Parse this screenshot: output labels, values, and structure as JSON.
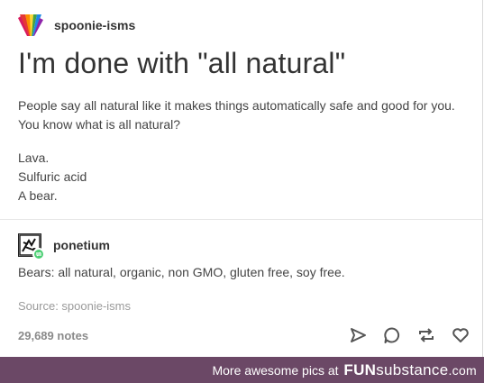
{
  "post": {
    "blog_name": "spoonie-isms",
    "title": "I'm done with \"all natural\"",
    "paragraph_1": "People say all natural like it makes things automatically safe and good for you. You know what is all natural?",
    "list_lines": [
      "Lava.",
      "Sulfuric acid",
      "A bear."
    ]
  },
  "reblog": {
    "blog_name": "ponetium",
    "text": "Bears: all natural, organic, non GMO, gluten free, soy free."
  },
  "source": "Source: spoonie-isms",
  "notes": "29,689 notes",
  "actions": {
    "icons": [
      "send-icon",
      "comment-icon",
      "reblog-icon",
      "heart-icon"
    ]
  },
  "footer": {
    "text": "More awesome pics at",
    "brand_bold": "FUN",
    "brand_rest": "substance",
    "brand_suffix": ".com",
    "background": "#6b4866"
  }
}
